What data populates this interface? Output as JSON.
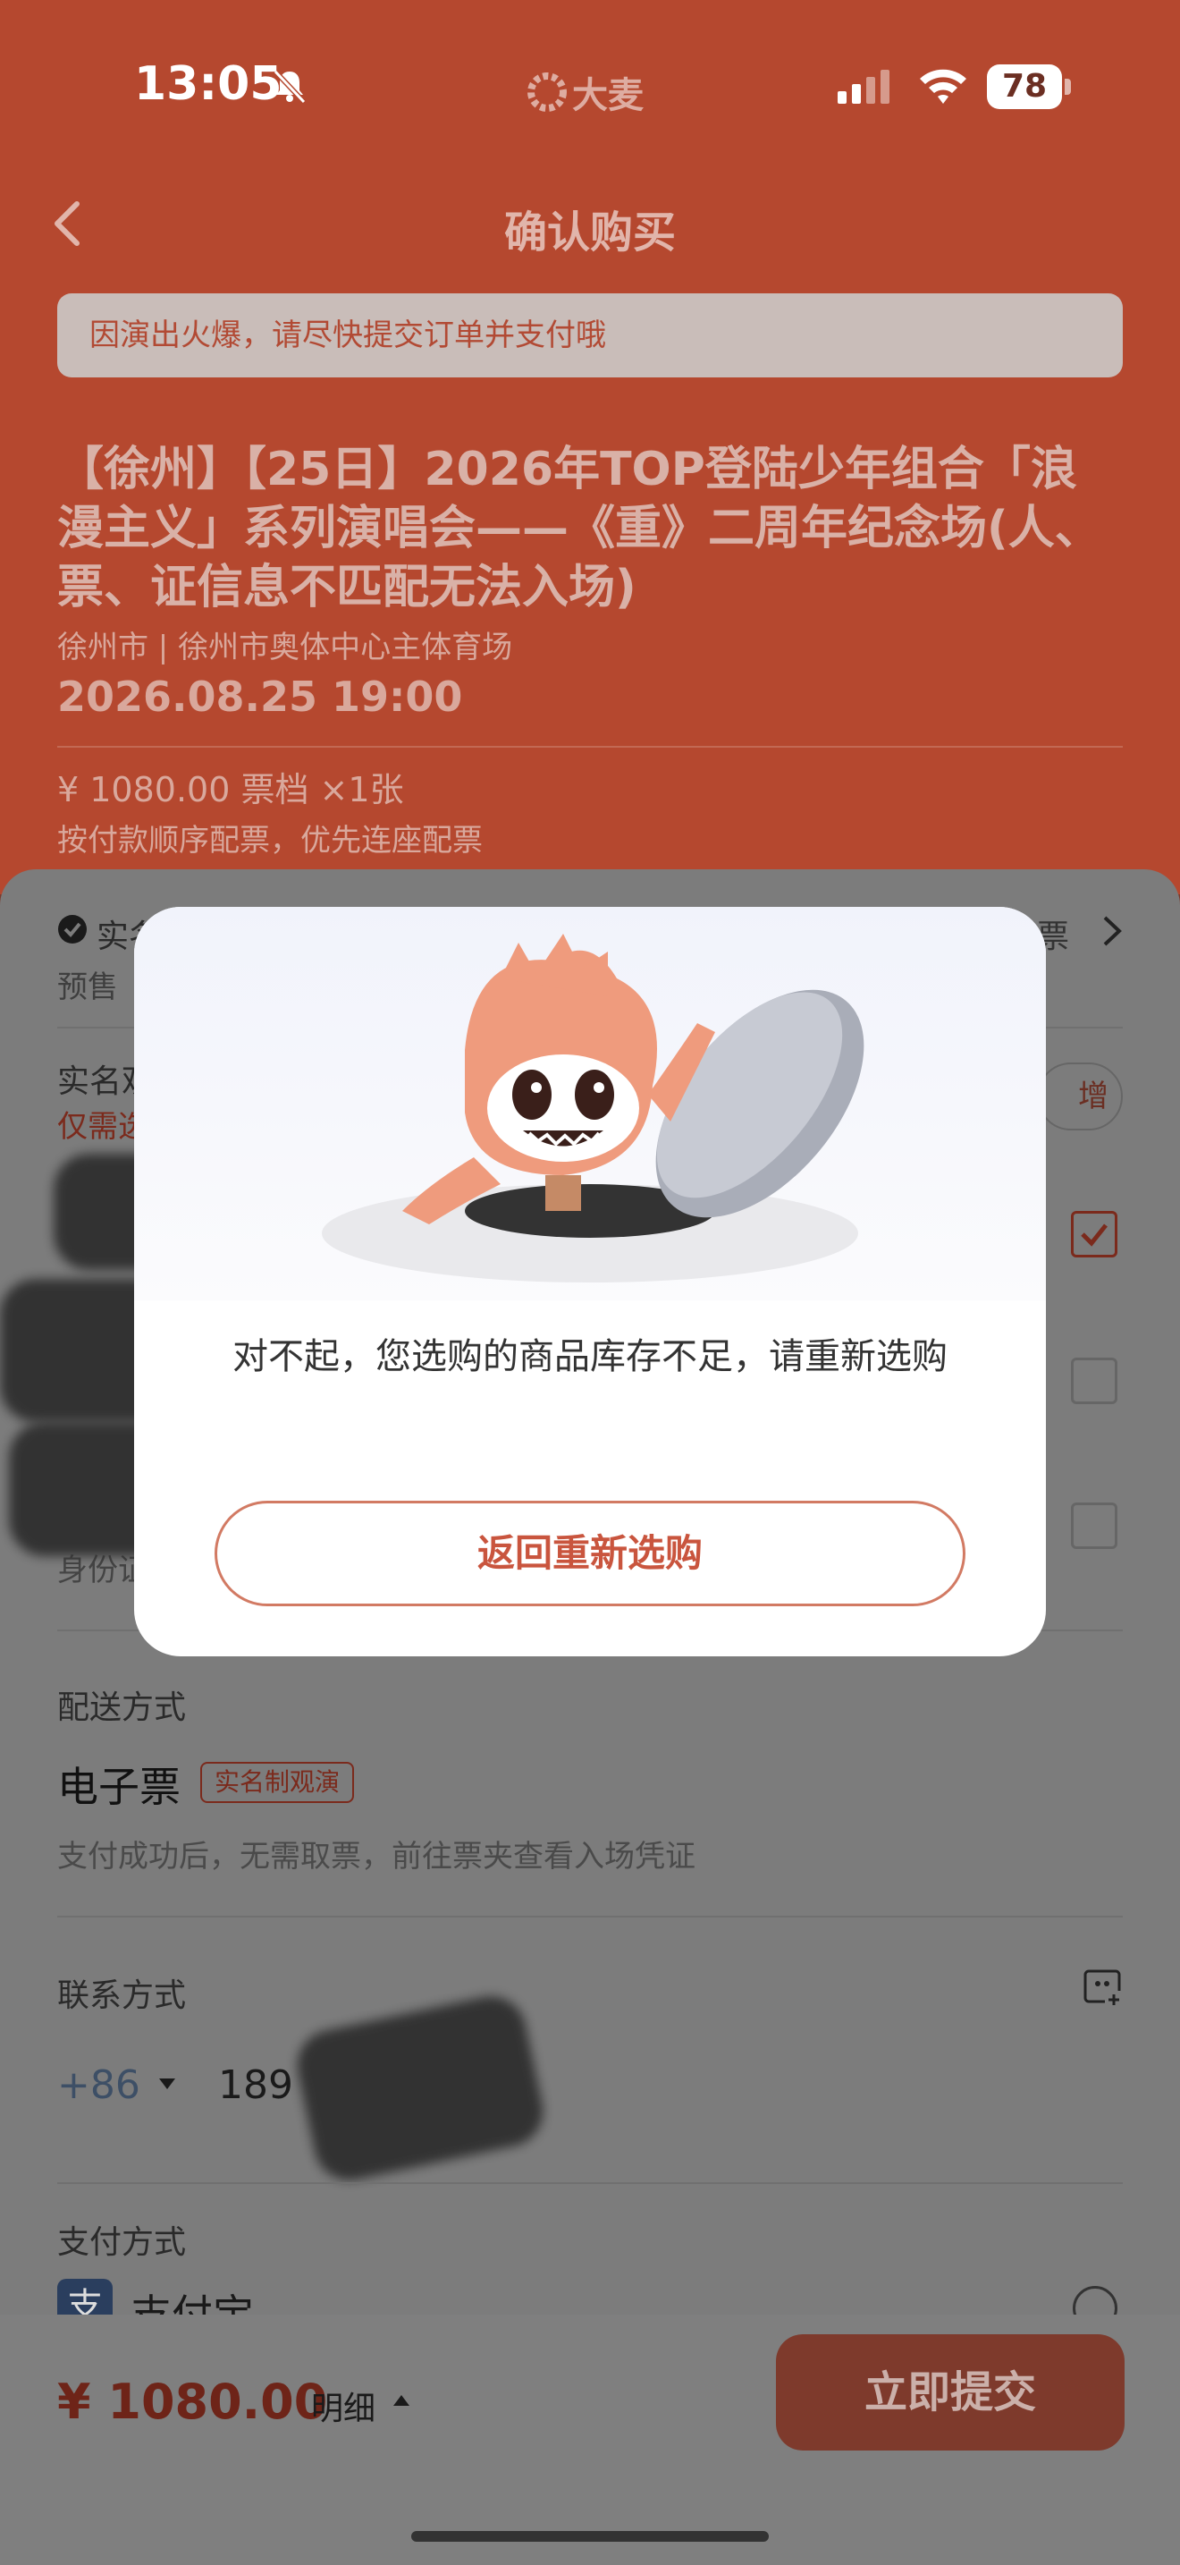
{
  "status_bar": {
    "time": "13:05",
    "brand": "大麦",
    "battery": "78"
  },
  "nav": {
    "title": "确认购买"
  },
  "notice": "因演出火爆，请尽快提交订单并支付哦",
  "event": {
    "title": "【徐州】【25日】2026年TOP登陆少年组合「浪漫主义」系列演唱会——《重》二周年纪念场(人、票、证信息不匹配无法入场)",
    "venue": "徐州市 | 徐州市奥体中心主体育场",
    "datetime": "2026.08.25 19:00",
    "price_tier": "¥ 1080.00 票档  ×1张",
    "seat_rule": "按付款顺序配票，优先连座配票"
  },
  "sheet": {
    "realname_label": "实名",
    "presale": "预售",
    "invoice": "发票",
    "viewer_title": "实名观",
    "viewer_hint": "仅需选",
    "add_label": "增",
    "id_label": "身份证",
    "delivery_label": "配送方式",
    "eticket": "电子票",
    "realname_badge": "实名制观演",
    "eticket_note": "支付成功后，无需取票，前往票夹查看入场凭证",
    "contact_label": "联系方式",
    "country_code": "+86",
    "phone": "189",
    "payment_label": "支付方式",
    "alipay_icon_text": "支",
    "alipay_name": "支付宝"
  },
  "bottom": {
    "total": "¥ 1080.00",
    "detail": "明细",
    "submit": "立即提交"
  },
  "modal": {
    "message": "对不起，您选购的商品库存不足，请重新选购",
    "button": "返回重新选购"
  },
  "colors": {
    "brand_red": "#b5482f",
    "accent": "#c9553e"
  }
}
